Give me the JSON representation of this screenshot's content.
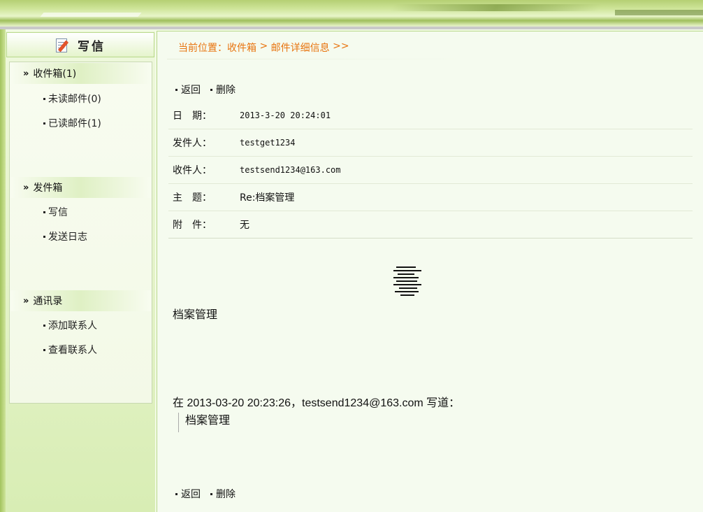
{
  "sidebar": {
    "compose_title": "写信",
    "groups": [
      {
        "title": "收件箱(1)",
        "items": [
          "未读邮件(0)",
          "已读邮件(1)"
        ]
      },
      {
        "title": "发件箱",
        "items": [
          "写信",
          "发送日志"
        ]
      },
      {
        "title": "通讯录",
        "items": [
          "添加联系人",
          "查看联系人"
        ]
      }
    ]
  },
  "breadcrumb": {
    "prefix": "当前位置：",
    "inbox": "收件箱",
    "sep": " > ",
    "current": "邮件详细信息",
    "tail": " >>"
  },
  "actions": {
    "back": "返回",
    "delete": "删除"
  },
  "mail": {
    "fields": [
      {
        "label": "日　期：",
        "value": "2013-3-20 20:24:01"
      },
      {
        "label": "发件人：",
        "value": "testget1234"
      },
      {
        "label": "收件人：",
        "value": "testsend1234@163.com"
      },
      {
        "label": "主　题：",
        "value": "Re:档案管理"
      },
      {
        "label": "附　件：",
        "value": "无"
      }
    ],
    "body": "档案管理",
    "quote_header": "在  2013-03-20 20:23:26，testsend1234@163.com 写道：",
    "quote_text": "档案管理"
  },
  "colors": {
    "accent": "#e8740f",
    "border": "#b8d88a",
    "banner": "#b5cf73"
  }
}
